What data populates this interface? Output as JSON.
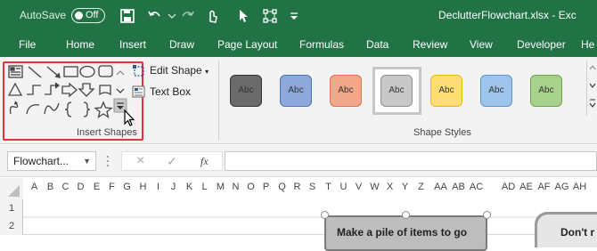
{
  "title_bar": {
    "autosave_label": "AutoSave",
    "autosave_state": "Off",
    "filename": "DeclutterFlowchart.xlsx - Exc",
    "icons": [
      "save-icon",
      "undo-icon",
      "redo-icon",
      "touch-mode-icon",
      "select-objects-icon",
      "selection-pane-icon",
      "customize-qat-icon"
    ],
    "bg_color": "#217346"
  },
  "tabs": [
    "File",
    "Home",
    "Insert",
    "Draw",
    "Page Layout",
    "Formulas",
    "Data",
    "Review",
    "View",
    "Developer",
    "He"
  ],
  "ribbon": {
    "insert_shapes": {
      "label": "Insert Shapes",
      "highlight_color": "#e8313f",
      "shapes": [
        "text-box-shape",
        "line",
        "arrow-line",
        "rectangle",
        "oval",
        "rounded-rectangle",
        "triangle",
        "elbow-connector",
        "elbow-arrow-connector",
        "block-arrow-right",
        "block-arrow-down",
        "curved-shape",
        "freeform",
        "curve",
        "scribble",
        "left-brace",
        "right-brace",
        "star"
      ],
      "more_label": "More Shapes"
    },
    "edit_shape_label": "Edit Shape",
    "text_box_label": "Text Box",
    "shape_styles": {
      "label": "Shape Styles",
      "items": [
        {
          "label": "Abc",
          "fill": "#6b6b6b",
          "border": "#333333"
        },
        {
          "label": "Abc",
          "fill": "#8ea8dc",
          "border": "#4f72b8"
        },
        {
          "label": "Abc",
          "fill": "#f2a78a",
          "border": "#e1714b"
        },
        {
          "label": "Abc",
          "fill": "#c8c8c8",
          "border": "#8e8e8e"
        },
        {
          "label": "Abc",
          "fill": "#ffdd77",
          "border": "#eeb800"
        },
        {
          "label": "Abc",
          "fill": "#9fc4ec",
          "border": "#5b93d6"
        },
        {
          "label": "Abc",
          "fill": "#a9d18e",
          "border": "#6ba544"
        }
      ]
    }
  },
  "formula_bar": {
    "name_box": "Flowchart...",
    "cancel_icon": "×",
    "enter_icon": "✓",
    "fx_label": "fx",
    "value": ""
  },
  "grid": {
    "columns": [
      "A",
      "B",
      "C",
      "D",
      "E",
      "F",
      "G",
      "H",
      "I",
      "J",
      "K",
      "L",
      "M",
      "N",
      "O",
      "P",
      "Q",
      "R",
      "S",
      "T",
      "U",
      "V",
      "W",
      "X",
      "Y",
      "Z",
      "AA",
      "AB",
      "AC"
    ],
    "rows": [
      "1",
      "2"
    ],
    "shape1_text": "Make a pile of items to go",
    "shape2_text": "Don't r"
  }
}
